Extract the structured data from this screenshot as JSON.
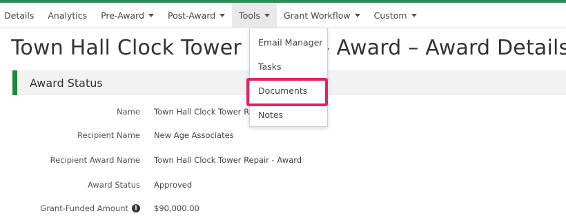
{
  "nav": {
    "items": [
      {
        "label": "Details",
        "caret": false
      },
      {
        "label": "Analytics",
        "caret": false
      },
      {
        "label": "Pre-Award",
        "caret": true
      },
      {
        "label": "Post-Award",
        "caret": true
      },
      {
        "label": "Tools",
        "caret": true,
        "active": true
      },
      {
        "label": "Grant Workflow",
        "caret": true
      },
      {
        "label": "Custom",
        "caret": true
      }
    ]
  },
  "page": {
    "title": "Town Hall Clock Tower Repair - Award – Award Details"
  },
  "section": {
    "title": "Award Status"
  },
  "fields": [
    {
      "label": "Name",
      "value": "Town Hall Clock Tower Repair - Award",
      "info": false
    },
    {
      "label": "Recipient Name",
      "value": "New Age Associates",
      "info": false
    },
    {
      "label": "Recipient Award Name",
      "value": "Town Hall Clock Tower Repair - Award",
      "info": false
    },
    {
      "label": "Award Status",
      "value": "Approved",
      "info": false
    },
    {
      "label": "Grant-Funded Amount",
      "value": "$90,000.00",
      "info": true
    }
  ],
  "tools_menu": {
    "items": [
      "Email Manager",
      "Tasks",
      "Documents",
      "Notes"
    ],
    "highlighted": "Documents"
  },
  "colors": {
    "accent_green": "#1e8a3c",
    "highlight": "#e0245e"
  }
}
